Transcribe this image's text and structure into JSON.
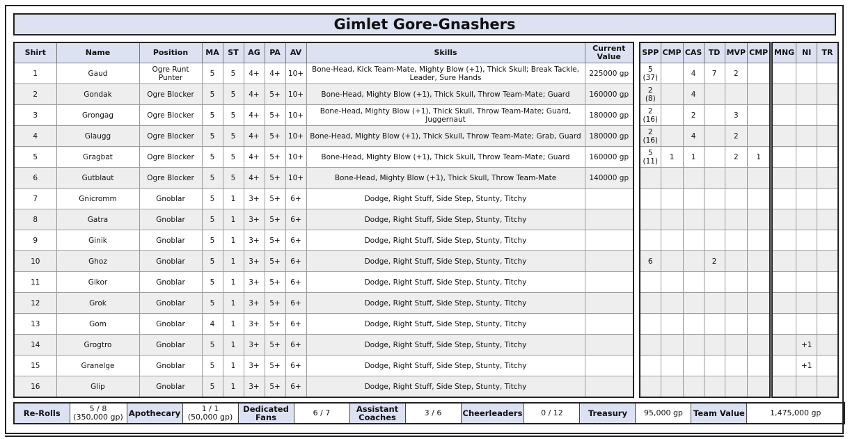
{
  "title": "Gimlet Gore-Gnashers",
  "roster_headers": [
    "Shirt",
    "Name",
    "Position",
    "MA",
    "ST",
    "AG",
    "PA",
    "AV",
    "Skills",
    "Current Value"
  ],
  "stats_headers": [
    "SPP",
    "CMP",
    "CAS",
    "TD",
    "MVP",
    "CMP"
  ],
  "misc_headers": [
    "MNG",
    "NI",
    "TR"
  ],
  "players": [
    {
      "shirt": "1",
      "name": "Gaud",
      "position": "Ogre Runt Punter",
      "ma": "5",
      "st": "5",
      "ag": "4+",
      "pa": "4+",
      "av": "10+",
      "skills": "Bone-Head, Kick Team-Mate, Mighty Blow (+1), Thick Skull; Break Tackle, Leader, Sure Hands",
      "value": "225000 gp",
      "spp": "5",
      "spp_sub": "(37)",
      "cmp": "",
      "cas": "4",
      "td": "7",
      "mvp": "2",
      "cmp2": "",
      "mng": "",
      "ni": "",
      "tr": ""
    },
    {
      "shirt": "2",
      "name": "Gondak",
      "position": "Ogre Blocker",
      "ma": "5",
      "st": "5",
      "ag": "4+",
      "pa": "5+",
      "av": "10+",
      "skills": "Bone-Head, Mighty Blow (+1), Thick Skull, Throw Team-Mate; Guard",
      "value": "160000 gp",
      "spp": "2",
      "spp_sub": "(8)",
      "cmp": "",
      "cas": "4",
      "td": "",
      "mvp": "",
      "cmp2": "",
      "mng": "",
      "ni": "",
      "tr": ""
    },
    {
      "shirt": "3",
      "name": "Grongag",
      "position": "Ogre Blocker",
      "ma": "5",
      "st": "5",
      "ag": "4+",
      "pa": "5+",
      "av": "10+",
      "skills": "Bone-Head, Mighty Blow (+1), Thick Skull, Throw Team-Mate; Guard, Juggernaut",
      "value": "180000 gp",
      "spp": "2",
      "spp_sub": "(16)",
      "cmp": "",
      "cas": "2",
      "td": "",
      "mvp": "3",
      "cmp2": "",
      "mng": "",
      "ni": "",
      "tr": ""
    },
    {
      "shirt": "4",
      "name": "Glaugg",
      "position": "Ogre Blocker",
      "ma": "5",
      "st": "5",
      "ag": "4+",
      "pa": "5+",
      "av": "10+",
      "skills": "Bone-Head, Mighty Blow (+1), Thick Skull, Throw Team-Mate; Grab, Guard",
      "value": "180000 gp",
      "spp": "2",
      "spp_sub": "(16)",
      "cmp": "",
      "cas": "4",
      "td": "",
      "mvp": "2",
      "cmp2": "",
      "mng": "",
      "ni": "",
      "tr": ""
    },
    {
      "shirt": "5",
      "name": "Gragbat",
      "position": "Ogre Blocker",
      "ma": "5",
      "st": "5",
      "ag": "4+",
      "pa": "5+",
      "av": "10+",
      "skills": "Bone-Head, Mighty Blow (+1), Thick Skull, Throw Team-Mate; Guard",
      "value": "160000 gp",
      "spp": "5",
      "spp_sub": "(11)",
      "cmp": "1",
      "cas": "1",
      "td": "",
      "mvp": "2",
      "cmp2": "1",
      "mng": "",
      "ni": "",
      "tr": ""
    },
    {
      "shirt": "6",
      "name": "Gutblaut",
      "position": "Ogre Blocker",
      "ma": "5",
      "st": "5",
      "ag": "4+",
      "pa": "5+",
      "av": "10+",
      "skills": "Bone-Head, Mighty Blow (+1), Thick Skull, Throw Team-Mate",
      "value": "140000 gp",
      "spp": "",
      "spp_sub": "",
      "cmp": "",
      "cas": "",
      "td": "",
      "mvp": "",
      "cmp2": "",
      "mng": "",
      "ni": "",
      "tr": ""
    },
    {
      "shirt": "7",
      "name": "Gnicromm",
      "position": "Gnoblar",
      "ma": "5",
      "st": "1",
      "ag": "3+",
      "pa": "5+",
      "av": "6+",
      "skills": "Dodge, Right Stuff, Side Step, Stunty, Titchy",
      "value": "",
      "spp": "",
      "spp_sub": "",
      "cmp": "",
      "cas": "",
      "td": "",
      "mvp": "",
      "cmp2": "",
      "mng": "",
      "ni": "",
      "tr": ""
    },
    {
      "shirt": "8",
      "name": "Gatra",
      "position": "Gnoblar",
      "ma": "5",
      "st": "1",
      "ag": "3+",
      "pa": "5+",
      "av": "6+",
      "skills": "Dodge, Right Stuff, Side Step, Stunty, Titchy",
      "value": "",
      "spp": "",
      "spp_sub": "",
      "cmp": "",
      "cas": "",
      "td": "",
      "mvp": "",
      "cmp2": "",
      "mng": "",
      "ni": "",
      "tr": ""
    },
    {
      "shirt": "9",
      "name": "Ginik",
      "position": "Gnoblar",
      "ma": "5",
      "st": "1",
      "ag": "3+",
      "pa": "5+",
      "av": "6+",
      "skills": "Dodge, Right Stuff, Side Step, Stunty, Titchy",
      "value": "",
      "spp": "",
      "spp_sub": "",
      "cmp": "",
      "cas": "",
      "td": "",
      "mvp": "",
      "cmp2": "",
      "mng": "",
      "ni": "",
      "tr": ""
    },
    {
      "shirt": "10",
      "name": "Ghoz",
      "position": "Gnoblar",
      "ma": "5",
      "st": "1",
      "ag": "3+",
      "pa": "5+",
      "av": "6+",
      "skills": "Dodge, Right Stuff, Side Step, Stunty, Titchy",
      "value": "",
      "spp": "6",
      "spp_sub": "",
      "cmp": "",
      "cas": "",
      "td": "2",
      "mvp": "",
      "cmp2": "",
      "mng": "",
      "ni": "",
      "tr": ""
    },
    {
      "shirt": "11",
      "name": "Gikor",
      "position": "Gnoblar",
      "ma": "5",
      "st": "1",
      "ag": "3+",
      "pa": "5+",
      "av": "6+",
      "skills": "Dodge, Right Stuff, Side Step, Stunty, Titchy",
      "value": "",
      "spp": "",
      "spp_sub": "",
      "cmp": "",
      "cas": "",
      "td": "",
      "mvp": "",
      "cmp2": "",
      "mng": "",
      "ni": "",
      "tr": ""
    },
    {
      "shirt": "12",
      "name": "Grok",
      "position": "Gnoblar",
      "ma": "5",
      "st": "1",
      "ag": "3+",
      "pa": "5+",
      "av": "6+",
      "skills": "Dodge, Right Stuff, Side Step, Stunty, Titchy",
      "value": "",
      "spp": "",
      "spp_sub": "",
      "cmp": "",
      "cas": "",
      "td": "",
      "mvp": "",
      "cmp2": "",
      "mng": "",
      "ni": "",
      "tr": ""
    },
    {
      "shirt": "13",
      "name": "Gom",
      "position": "Gnoblar",
      "ma": "4",
      "st": "1",
      "ag": "3+",
      "pa": "5+",
      "av": "6+",
      "skills": "Dodge, Right Stuff, Side Step, Stunty, Titchy",
      "value": "",
      "spp": "",
      "spp_sub": "",
      "cmp": "",
      "cas": "",
      "td": "",
      "mvp": "",
      "cmp2": "",
      "mng": "",
      "ni": "",
      "tr": ""
    },
    {
      "shirt": "14",
      "name": "Grogtro",
      "position": "Gnoblar",
      "ma": "5",
      "st": "1",
      "ag": "3+",
      "pa": "5+",
      "av": "6+",
      "skills": "Dodge, Right Stuff, Side Step, Stunty, Titchy",
      "value": "",
      "spp": "",
      "spp_sub": "",
      "cmp": "",
      "cas": "",
      "td": "",
      "mvp": "",
      "cmp2": "",
      "mng": "",
      "ni": "+1",
      "tr": ""
    },
    {
      "shirt": "15",
      "name": "Granelge",
      "position": "Gnoblar",
      "ma": "5",
      "st": "1",
      "ag": "3+",
      "pa": "5+",
      "av": "6+",
      "skills": "Dodge, Right Stuff, Side Step, Stunty, Titchy",
      "value": "",
      "spp": "",
      "spp_sub": "",
      "cmp": "",
      "cas": "",
      "td": "",
      "mvp": "",
      "cmp2": "",
      "mng": "",
      "ni": "+1",
      "tr": ""
    },
    {
      "shirt": "16",
      "name": "Glip",
      "position": "Gnoblar",
      "ma": "5",
      "st": "1",
      "ag": "3+",
      "pa": "5+",
      "av": "6+",
      "skills": "Dodge, Right Stuff, Side Step, Stunty, Titchy",
      "value": "",
      "spp": "",
      "spp_sub": "",
      "cmp": "",
      "cas": "",
      "td": "",
      "mvp": "",
      "cmp2": "",
      "mng": "",
      "ni": "",
      "tr": ""
    }
  ],
  "footer": {
    "rerolls_label": "Re-Rolls",
    "rerolls_value": "5 / 8",
    "rerolls_cost": "(350,000 gp)",
    "apothecary_label": "Apothecary",
    "apothecary_value": "1 / 1",
    "apothecary_cost": "(50,000 gp)",
    "fans_label": "Dedicated Fans",
    "fans_value": "6 / 7",
    "coaches_label": "Assistant Coaches",
    "coaches_value": "3 / 6",
    "cheerleaders_label": "Cheerleaders",
    "cheerleaders_value": "0 / 12",
    "treasury_label": "Treasury",
    "treasury_value": "95,000 gp",
    "team_value_label": "Team Value",
    "team_value_value": "1,475,000 gp"
  }
}
